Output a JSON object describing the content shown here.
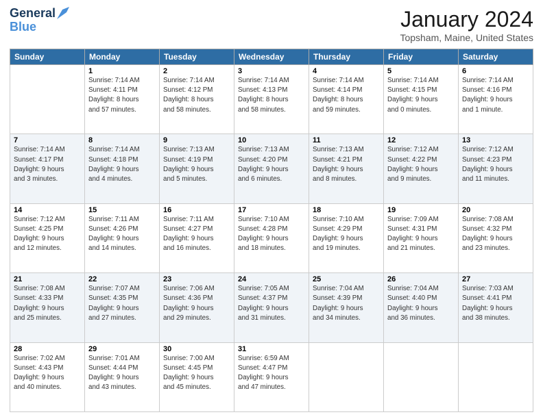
{
  "header": {
    "logo_line1": "General",
    "logo_line2": "Blue",
    "month": "January 2024",
    "location": "Topsham, Maine, United States"
  },
  "days_of_week": [
    "Sunday",
    "Monday",
    "Tuesday",
    "Wednesday",
    "Thursday",
    "Friday",
    "Saturday"
  ],
  "weeks": [
    [
      {
        "day": "",
        "sunrise": "",
        "sunset": "",
        "daylight": ""
      },
      {
        "day": "1",
        "sunrise": "Sunrise: 7:14 AM",
        "sunset": "Sunset: 4:11 PM",
        "daylight": "Daylight: 8 hours and 57 minutes."
      },
      {
        "day": "2",
        "sunrise": "Sunrise: 7:14 AM",
        "sunset": "Sunset: 4:12 PM",
        "daylight": "Daylight: 8 hours and 58 minutes."
      },
      {
        "day": "3",
        "sunrise": "Sunrise: 7:14 AM",
        "sunset": "Sunset: 4:13 PM",
        "daylight": "Daylight: 8 hours and 58 minutes."
      },
      {
        "day": "4",
        "sunrise": "Sunrise: 7:14 AM",
        "sunset": "Sunset: 4:14 PM",
        "daylight": "Daylight: 8 hours and 59 minutes."
      },
      {
        "day": "5",
        "sunrise": "Sunrise: 7:14 AM",
        "sunset": "Sunset: 4:15 PM",
        "daylight": "Daylight: 9 hours and 0 minutes."
      },
      {
        "day": "6",
        "sunrise": "Sunrise: 7:14 AM",
        "sunset": "Sunset: 4:16 PM",
        "daylight": "Daylight: 9 hours and 1 minute."
      }
    ],
    [
      {
        "day": "7",
        "sunrise": "Sunrise: 7:14 AM",
        "sunset": "Sunset: 4:17 PM",
        "daylight": "Daylight: 9 hours and 3 minutes."
      },
      {
        "day": "8",
        "sunrise": "Sunrise: 7:14 AM",
        "sunset": "Sunset: 4:18 PM",
        "daylight": "Daylight: 9 hours and 4 minutes."
      },
      {
        "day": "9",
        "sunrise": "Sunrise: 7:13 AM",
        "sunset": "Sunset: 4:19 PM",
        "daylight": "Daylight: 9 hours and 5 minutes."
      },
      {
        "day": "10",
        "sunrise": "Sunrise: 7:13 AM",
        "sunset": "Sunset: 4:20 PM",
        "daylight": "Daylight: 9 hours and 6 minutes."
      },
      {
        "day": "11",
        "sunrise": "Sunrise: 7:13 AM",
        "sunset": "Sunset: 4:21 PM",
        "daylight": "Daylight: 9 hours and 8 minutes."
      },
      {
        "day": "12",
        "sunrise": "Sunrise: 7:12 AM",
        "sunset": "Sunset: 4:22 PM",
        "daylight": "Daylight: 9 hours and 9 minutes."
      },
      {
        "day": "13",
        "sunrise": "Sunrise: 7:12 AM",
        "sunset": "Sunset: 4:23 PM",
        "daylight": "Daylight: 9 hours and 11 minutes."
      }
    ],
    [
      {
        "day": "14",
        "sunrise": "Sunrise: 7:12 AM",
        "sunset": "Sunset: 4:25 PM",
        "daylight": "Daylight: 9 hours and 12 minutes."
      },
      {
        "day": "15",
        "sunrise": "Sunrise: 7:11 AM",
        "sunset": "Sunset: 4:26 PM",
        "daylight": "Daylight: 9 hours and 14 minutes."
      },
      {
        "day": "16",
        "sunrise": "Sunrise: 7:11 AM",
        "sunset": "Sunset: 4:27 PM",
        "daylight": "Daylight: 9 hours and 16 minutes."
      },
      {
        "day": "17",
        "sunrise": "Sunrise: 7:10 AM",
        "sunset": "Sunset: 4:28 PM",
        "daylight": "Daylight: 9 hours and 18 minutes."
      },
      {
        "day": "18",
        "sunrise": "Sunrise: 7:10 AM",
        "sunset": "Sunset: 4:29 PM",
        "daylight": "Daylight: 9 hours and 19 minutes."
      },
      {
        "day": "19",
        "sunrise": "Sunrise: 7:09 AM",
        "sunset": "Sunset: 4:31 PM",
        "daylight": "Daylight: 9 hours and 21 minutes."
      },
      {
        "day": "20",
        "sunrise": "Sunrise: 7:08 AM",
        "sunset": "Sunset: 4:32 PM",
        "daylight": "Daylight: 9 hours and 23 minutes."
      }
    ],
    [
      {
        "day": "21",
        "sunrise": "Sunrise: 7:08 AM",
        "sunset": "Sunset: 4:33 PM",
        "daylight": "Daylight: 9 hours and 25 minutes."
      },
      {
        "day": "22",
        "sunrise": "Sunrise: 7:07 AM",
        "sunset": "Sunset: 4:35 PM",
        "daylight": "Daylight: 9 hours and 27 minutes."
      },
      {
        "day": "23",
        "sunrise": "Sunrise: 7:06 AM",
        "sunset": "Sunset: 4:36 PM",
        "daylight": "Daylight: 9 hours and 29 minutes."
      },
      {
        "day": "24",
        "sunrise": "Sunrise: 7:05 AM",
        "sunset": "Sunset: 4:37 PM",
        "daylight": "Daylight: 9 hours and 31 minutes."
      },
      {
        "day": "25",
        "sunrise": "Sunrise: 7:04 AM",
        "sunset": "Sunset: 4:39 PM",
        "daylight": "Daylight: 9 hours and 34 minutes."
      },
      {
        "day": "26",
        "sunrise": "Sunrise: 7:04 AM",
        "sunset": "Sunset: 4:40 PM",
        "daylight": "Daylight: 9 hours and 36 minutes."
      },
      {
        "day": "27",
        "sunrise": "Sunrise: 7:03 AM",
        "sunset": "Sunset: 4:41 PM",
        "daylight": "Daylight: 9 hours and 38 minutes."
      }
    ],
    [
      {
        "day": "28",
        "sunrise": "Sunrise: 7:02 AM",
        "sunset": "Sunset: 4:43 PM",
        "daylight": "Daylight: 9 hours and 40 minutes."
      },
      {
        "day": "29",
        "sunrise": "Sunrise: 7:01 AM",
        "sunset": "Sunset: 4:44 PM",
        "daylight": "Daylight: 9 hours and 43 minutes."
      },
      {
        "day": "30",
        "sunrise": "Sunrise: 7:00 AM",
        "sunset": "Sunset: 4:45 PM",
        "daylight": "Daylight: 9 hours and 45 minutes."
      },
      {
        "day": "31",
        "sunrise": "Sunrise: 6:59 AM",
        "sunset": "Sunset: 4:47 PM",
        "daylight": "Daylight: 9 hours and 47 minutes."
      },
      {
        "day": "",
        "sunrise": "",
        "sunset": "",
        "daylight": ""
      },
      {
        "day": "",
        "sunrise": "",
        "sunset": "",
        "daylight": ""
      },
      {
        "day": "",
        "sunrise": "",
        "sunset": "",
        "daylight": ""
      }
    ]
  ],
  "row_styles": [
    "white",
    "alt",
    "white",
    "alt",
    "white"
  ]
}
